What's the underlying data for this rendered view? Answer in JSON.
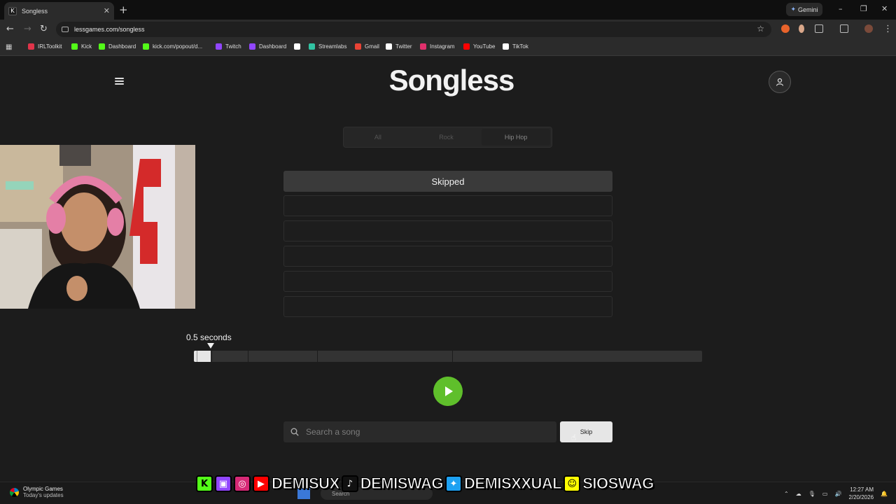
{
  "browser": {
    "tab_title": "Songless",
    "tab_favicon": "K",
    "tab_close": "✕",
    "new_tab": "+",
    "gemini_label": "Gemini",
    "url": "lessgames.com/songless",
    "bookmarks": [
      {
        "label": "IRLToolkit",
        "icon": "irltoolkit-icon",
        "color": "#e0344a"
      },
      {
        "label": "Kick",
        "icon": "kick-icon",
        "color": "#53fc18"
      },
      {
        "label": "Dashboard",
        "icon": "kick-icon",
        "color": "#53fc18"
      },
      {
        "label": "kick.com/popout/d...",
        "icon": "kick-icon",
        "color": "#53fc18"
      },
      {
        "label": "Twitch",
        "icon": "twitch-icon",
        "color": "#9146ff"
      },
      {
        "label": "Dashboard",
        "icon": "twitch-icon",
        "color": "#9146ff"
      },
      {
        "label": "",
        "icon": "diamond-icon",
        "color": "#ffffff"
      },
      {
        "label": "Streamlabs",
        "icon": "streamlabs-icon",
        "color": "#31c3a2"
      },
      {
        "label": "Gmail",
        "icon": "gmail-icon",
        "color": "#ea4335"
      },
      {
        "label": "Twitter",
        "icon": "x-icon",
        "color": "#ffffff"
      },
      {
        "label": "Instagram",
        "icon": "instagram-icon",
        "color": "#e1306c"
      },
      {
        "label": "YouTube",
        "icon": "youtube-icon",
        "color": "#ff0000"
      },
      {
        "label": "TikTok",
        "icon": "tiktok-icon",
        "color": "#ffffff"
      }
    ]
  },
  "app": {
    "logo": "Songless",
    "genre_tabs": [
      "All",
      "Rock",
      "Hip Hop"
    ],
    "active_genre": "Hip Hop",
    "guesses": [
      "Skipped",
      "",
      "",
      "",
      "",
      ""
    ],
    "duration_label": "0.5 seconds",
    "progress_fraction": 0.033,
    "search_placeholder": "Search a song",
    "skip_label": "Skip",
    "play_color": "#5fbf2b"
  },
  "overlay": {
    "handles": [
      "DEMISUX",
      "DEMISWAG",
      "DEMISXXUAL",
      "SIOSWAG"
    ]
  },
  "taskbar": {
    "news_title": "Olympic Games",
    "news_sub": "Today's updates",
    "search_label": "Search",
    "time": "12:27 AM",
    "date": "2/20/2026"
  }
}
